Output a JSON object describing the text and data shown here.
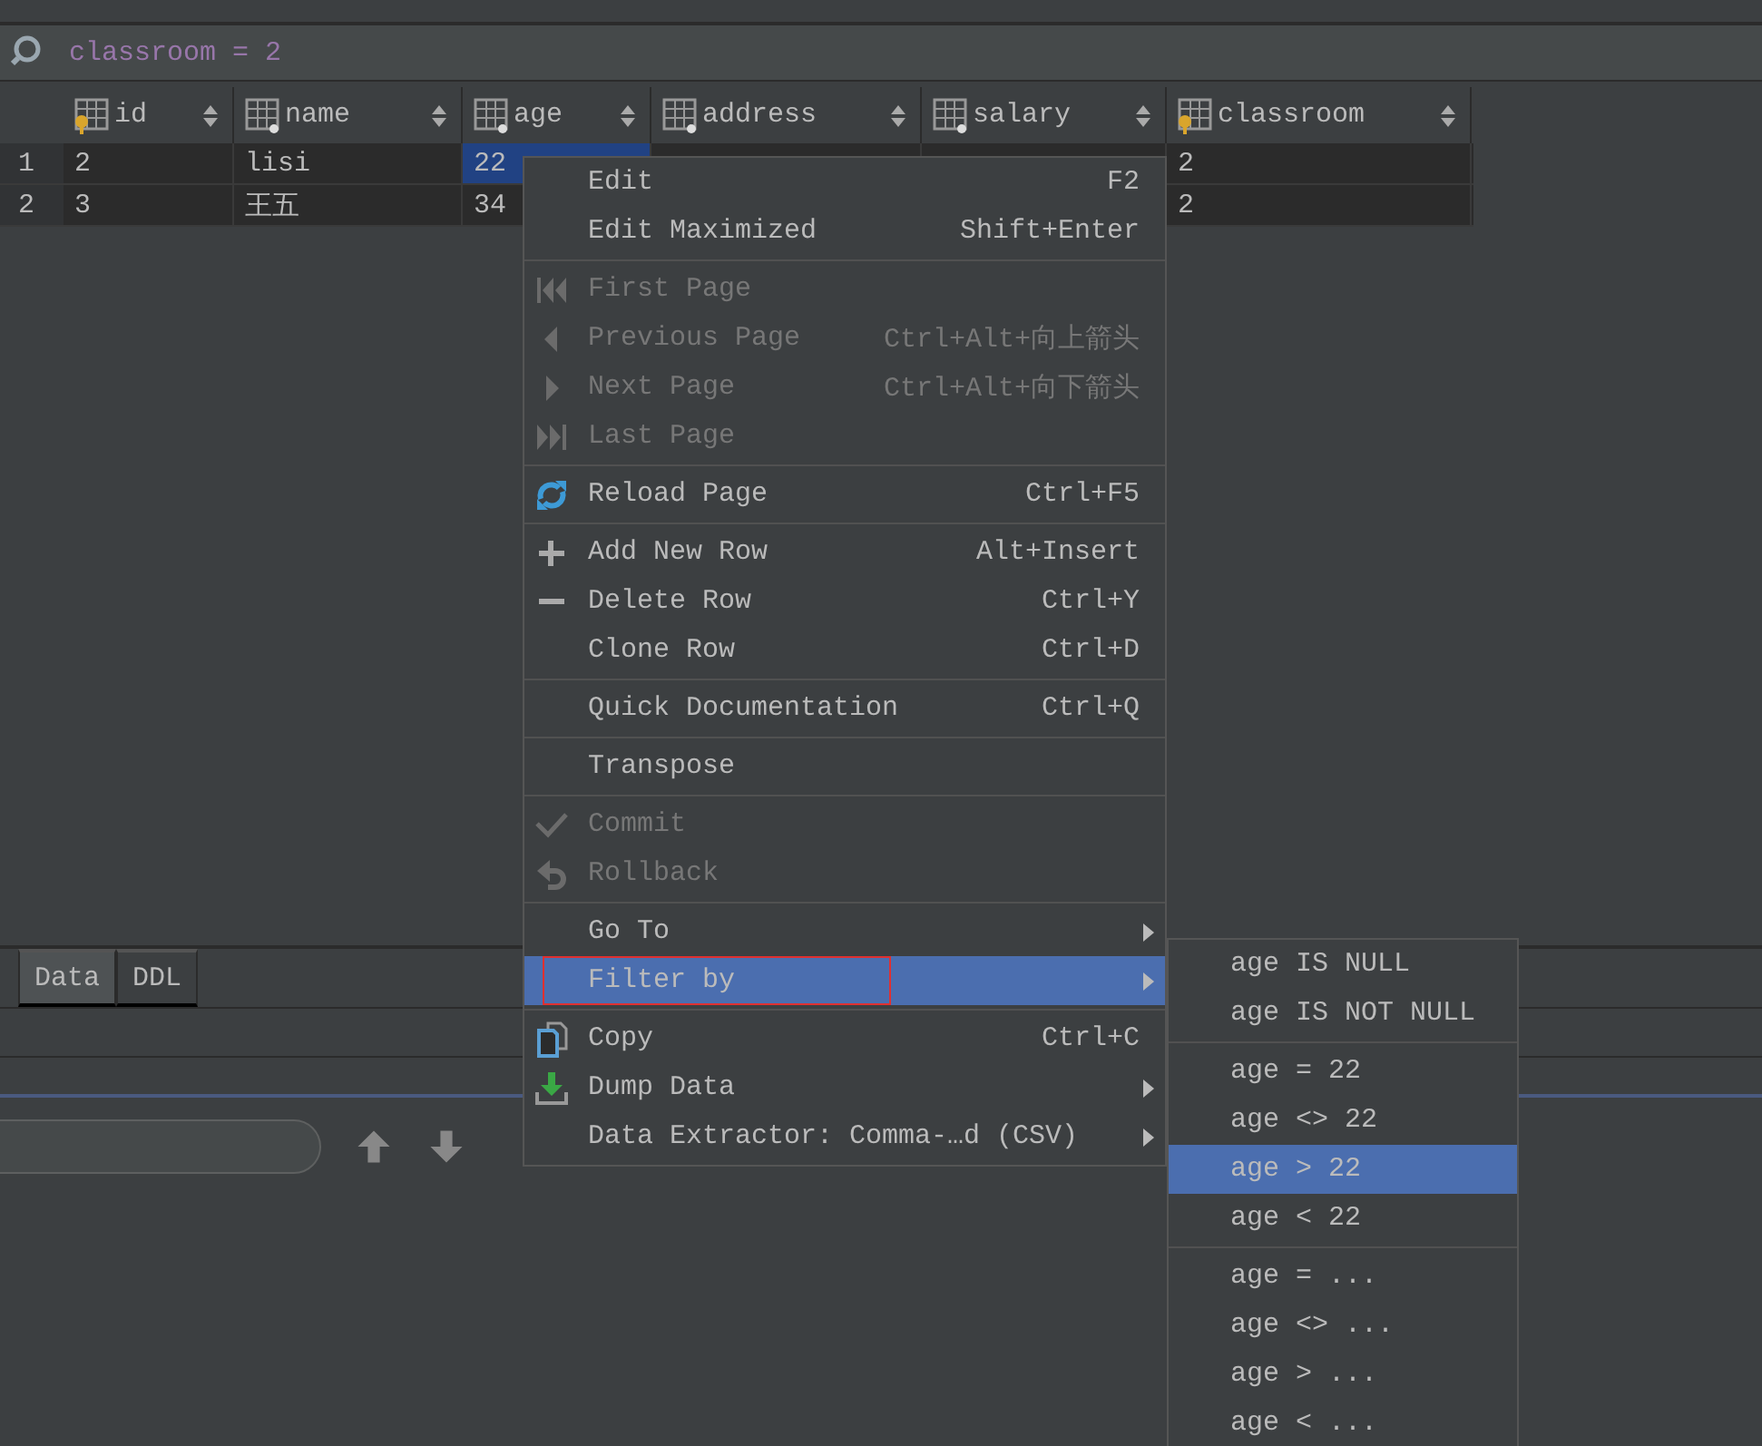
{
  "filter_bar": {
    "text": "classroom = 2"
  },
  "table": {
    "columns": [
      {
        "label": "id",
        "key": true
      },
      {
        "label": "name",
        "key": false
      },
      {
        "label": "age",
        "key": false
      },
      {
        "label": "address",
        "key": false
      },
      {
        "label": "salary",
        "key": false
      },
      {
        "label": "classroom",
        "key": true
      }
    ],
    "rows": [
      {
        "number": "1",
        "cells": [
          {
            "text": "2",
            "selected": false
          },
          {
            "text": "lisi",
            "selected": false
          },
          {
            "text": "22",
            "selected": true
          },
          null,
          null,
          {
            "text": "2",
            "selected": false
          }
        ]
      },
      {
        "number": "2",
        "cells": [
          {
            "text": "3",
            "selected": false
          },
          {
            "text": "王五",
            "selected": false
          },
          {
            "text": "34",
            "selected": false
          },
          null,
          null,
          {
            "text": "2",
            "selected": false
          }
        ]
      }
    ]
  },
  "tabs": [
    {
      "label": "Data",
      "selected": true
    },
    {
      "label": "DDL",
      "selected": false
    }
  ],
  "context_menu": [
    {
      "kind": "item",
      "label": "Edit",
      "shortcut": "F2",
      "disabled": false,
      "selected": false,
      "submenu": false
    },
    {
      "kind": "item",
      "label": "Edit Maximized",
      "shortcut": "Shift+Enter",
      "disabled": false,
      "selected": false,
      "submenu": false
    },
    {
      "kind": "separator"
    },
    {
      "kind": "item",
      "label": "First Page",
      "disabled": true,
      "selected": false,
      "submenu": false
    },
    {
      "kind": "item",
      "label": "Previous Page",
      "shortcut": "Ctrl+Alt+向上箭头",
      "disabled": true,
      "selected": false,
      "submenu": false
    },
    {
      "kind": "item",
      "label": "Next Page",
      "shortcut": "Ctrl+Alt+向下箭头",
      "disabled": true,
      "selected": false,
      "submenu": false
    },
    {
      "kind": "item",
      "label": "Last Page",
      "disabled": true,
      "selected": false,
      "submenu": false
    },
    {
      "kind": "separator"
    },
    {
      "kind": "item",
      "label": "Reload Page",
      "shortcut": "Ctrl+F5",
      "disabled": false,
      "selected": false,
      "submenu": false
    },
    {
      "kind": "separator"
    },
    {
      "kind": "item",
      "label": "Add New Row",
      "shortcut": "Alt+Insert",
      "disabled": false,
      "selected": false,
      "submenu": false
    },
    {
      "kind": "item",
      "label": "Delete Row",
      "shortcut": "Ctrl+Y",
      "disabled": false,
      "selected": false,
      "submenu": false
    },
    {
      "kind": "item",
      "label": "Clone Row",
      "shortcut": "Ctrl+D",
      "disabled": false,
      "selected": false,
      "submenu": false
    },
    {
      "kind": "separator"
    },
    {
      "kind": "item",
      "label": "Quick Documentation",
      "shortcut": "Ctrl+Q",
      "disabled": false,
      "selected": false,
      "submenu": false
    },
    {
      "kind": "separator"
    },
    {
      "kind": "item",
      "label": "Transpose",
      "disabled": false,
      "selected": false,
      "submenu": false
    },
    {
      "kind": "separator"
    },
    {
      "kind": "item",
      "label": "Commit",
      "disabled": true,
      "selected": false,
      "submenu": false
    },
    {
      "kind": "item",
      "label": "Rollback",
      "disabled": true,
      "selected": false,
      "submenu": false
    },
    {
      "kind": "separator"
    },
    {
      "kind": "item",
      "label": "Go To",
      "disabled": false,
      "selected": false,
      "submenu": true
    },
    {
      "kind": "item",
      "label": "Filter by",
      "disabled": false,
      "selected": true,
      "submenu": true,
      "annotated": true
    },
    {
      "kind": "separator"
    },
    {
      "kind": "item",
      "label": "Copy",
      "shortcut": "Ctrl+C",
      "disabled": false,
      "selected": false,
      "submenu": false
    },
    {
      "kind": "item",
      "label": "Dump Data",
      "disabled": false,
      "selected": false,
      "submenu": true
    },
    {
      "kind": "item",
      "label": "Data Extractor: Comma-…d (CSV)",
      "disabled": false,
      "selected": false,
      "submenu": true
    }
  ],
  "submenu": [
    {
      "kind": "item",
      "label": "age IS NULL",
      "selected": false
    },
    {
      "kind": "item",
      "label": "age IS NOT NULL",
      "selected": false
    },
    {
      "kind": "separator"
    },
    {
      "kind": "item",
      "label": "age = 22",
      "selected": false
    },
    {
      "kind": "item",
      "label": "age <> 22",
      "selected": false
    },
    {
      "kind": "item",
      "label": "age > 22",
      "selected": true
    },
    {
      "kind": "item",
      "label": "age < 22",
      "selected": false
    },
    {
      "kind": "separator"
    },
    {
      "kind": "item",
      "label": "age = ...",
      "selected": false
    },
    {
      "kind": "item",
      "label": "age <> ...",
      "selected": false
    },
    {
      "kind": "item",
      "label": "age > ...",
      "selected": false
    },
    {
      "kind": "item",
      "label": "age < ...",
      "selected": false
    }
  ]
}
